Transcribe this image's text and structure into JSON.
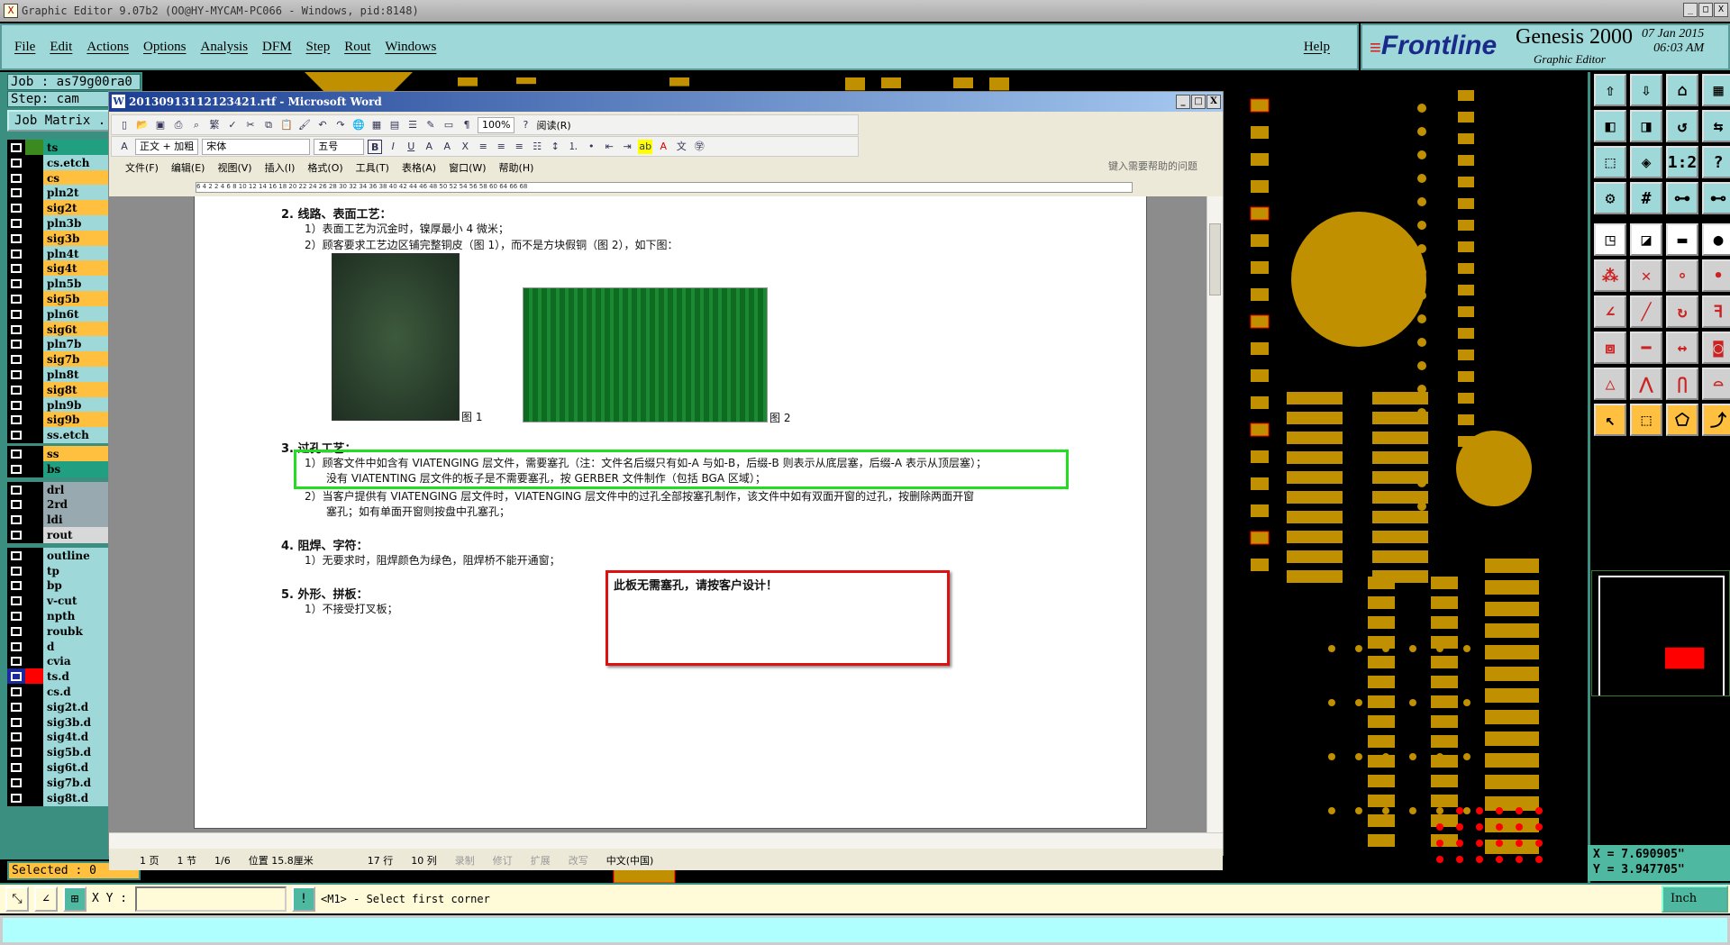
{
  "app": {
    "title": "Graphic Editor 9.07b2 (OO@HY-MYCAM-PC066 - Windows, pid:8148)",
    "window_buttons": [
      "_",
      "□",
      "X"
    ]
  },
  "menu": {
    "items": [
      "File",
      "Edit",
      "Actions",
      "Options",
      "Analysis",
      "DFM",
      "Step",
      "Rout",
      "Windows"
    ],
    "help": "Help"
  },
  "brand": {
    "logo": "Frontline",
    "product": "Genesis 2000",
    "subtitle": "Graphic Editor",
    "date": "07 Jan 2015",
    "time": "06:03 AM"
  },
  "left": {
    "job": "Job : as79g00ra0",
    "step": "Step: cam",
    "job_matrix": "Job Matrix ...",
    "selected": "Selected : 0",
    "layers": [
      {
        "name": "ts",
        "color": "#20a080",
        "swatch": "#3a8a20"
      },
      {
        "name": "cs.etch",
        "color": "#9ed8d8"
      },
      {
        "name": "cs",
        "color": "#ffc040"
      },
      {
        "name": "pln2t",
        "color": "#9ed8d8"
      },
      {
        "name": "sig2t",
        "color": "#ffc040"
      },
      {
        "name": "pln3b",
        "color": "#9ed8d8"
      },
      {
        "name": "sig3b",
        "color": "#ffc040"
      },
      {
        "name": "pln4t",
        "color": "#9ed8d8"
      },
      {
        "name": "sig4t",
        "color": "#ffc040"
      },
      {
        "name": "pln5b",
        "color": "#9ed8d8"
      },
      {
        "name": "sig5b",
        "color": "#ffc040"
      },
      {
        "name": "pln6t",
        "color": "#9ed8d8"
      },
      {
        "name": "sig6t",
        "color": "#ffc040"
      },
      {
        "name": "pln7b",
        "color": "#9ed8d8"
      },
      {
        "name": "sig7b",
        "color": "#ffc040"
      },
      {
        "name": "pln8t",
        "color": "#9ed8d8"
      },
      {
        "name": "sig8t",
        "color": "#ffc040"
      },
      {
        "name": "pln9b",
        "color": "#9ed8d8"
      },
      {
        "name": "sig9b",
        "color": "#ffc040"
      },
      {
        "name": "ss.etch",
        "color": "#9ed8d8"
      },
      {
        "name": "ss",
        "color": "#ffc040"
      },
      {
        "name": "bs",
        "color": "#20a080"
      },
      {
        "name": "drl",
        "color": "#98aab0"
      },
      {
        "name": "2rd",
        "color": "#98aab0"
      },
      {
        "name": "ldi",
        "color": "#98aab0"
      },
      {
        "name": "rout",
        "color": "#d8d8d8"
      },
      {
        "name": "outline",
        "color": "#9ed8d8"
      },
      {
        "name": "tp",
        "color": "#9ed8d8"
      },
      {
        "name": "bp",
        "color": "#9ed8d8"
      },
      {
        "name": "v-cut",
        "color": "#9ed8d8"
      },
      {
        "name": "npth",
        "color": "#9ed8d8"
      },
      {
        "name": "roubk",
        "color": "#9ed8d8"
      },
      {
        "name": "d",
        "color": "#9ed8d8"
      },
      {
        "name": "cvia",
        "color": "#9ed8d8"
      },
      {
        "name": "ts.d",
        "color": "#9ed8d8",
        "swatch": "#ff0000",
        "active": true
      },
      {
        "name": "cs.d",
        "color": "#9ed8d8"
      },
      {
        "name": "sig2t.d",
        "color": "#9ed8d8"
      },
      {
        "name": "sig3b.d",
        "color": "#9ed8d8"
      },
      {
        "name": "sig4t.d",
        "color": "#9ed8d8"
      },
      {
        "name": "sig5b.d",
        "color": "#9ed8d8"
      },
      {
        "name": "sig6t.d",
        "color": "#9ed8d8"
      },
      {
        "name": "sig7b.d",
        "color": "#9ed8d8"
      },
      {
        "name": "sig8t.d",
        "color": "#9ed8d8"
      }
    ]
  },
  "command": {
    "xy_label": "X Y :",
    "xy_value": "",
    "prompt": "<M1> - Select first corner",
    "unit": "Inch"
  },
  "coords": {
    "x": "X = 7.690905\"",
    "y": "Y = 3.947705\""
  },
  "word": {
    "title": "20130913112123421.rtf - Microsoft Word",
    "zoom": "100%",
    "read": "阅读(R)",
    "style": "正文 + 加粗",
    "font": "宋体",
    "size": "五号",
    "menu": [
      "文件(F)",
      "编辑(E)",
      "视图(V)",
      "插入(I)",
      "格式(O)",
      "工具(T)",
      "表格(A)",
      "窗口(W)",
      "帮助(H)"
    ],
    "help_placeholder": "键入需要帮助的问题",
    "ruler": "6  4  2     2  4  6  8  10  12  14  16  18  20  22  24  26  28  30  32  34  36  38  40  42  44  46  48  50  52  54  56  58  60     64  66  68",
    "doc": {
      "s2_title": "2.  线路、表面工艺：",
      "s2_1": "1）表面工艺为沉金时，镍厚最小 4 微米；",
      "s2_2": "2）顾客要求工艺边区铺完整铜皮（图 1），而不是方块假铜（图 2），如下图：",
      "fig1": "图 1",
      "fig2": "图 2",
      "s3_title": "3.  过孔工艺：",
      "s3_1a": "1）顾客文件中如含有 VIATENGING 层文件，需要塞孔（注：文件名后缀只有如-A 与如-B，后缀-B 则表示从底层塞，后缀-A 表示从顶层塞）；",
      "s3_1b": "没有 VIATENTING 层文件的板子是不需要塞孔，按 GERBER 文件制作（包括 BGA 区域）；",
      "s3_2a": "2）当客户提供有 VIATENGING 层文件时，VIATENGING 层文件中的过孔全部按塞孔制作，该文件中如有双面开窗的过孔，按删除两面开窗",
      "s3_2b": "塞孔；如有单面开窗则按盘中孔塞孔；",
      "s4_title": "4.  阻焊、字符：",
      "s4_1": "1）无要求时，阻焊颜色为绿色，阻焊桥不能开通窗；",
      "s5_title": "5.  外形、拼板：",
      "s5_1": "1）不接受打叉板；",
      "note": "此板无需塞孔，请按客户设计！"
    },
    "status": [
      "1 页",
      "1 节",
      "1/6",
      "位置 15.8厘米",
      "17 行",
      "10 列",
      "录制",
      "修订",
      "扩展",
      "改写",
      "中文(中国)"
    ]
  },
  "colors": {
    "highlight_green": "#22dd22",
    "note_red": "#dd1111",
    "pad_gold": "#c09000",
    "panel_cyan": "#9ed8d8"
  }
}
